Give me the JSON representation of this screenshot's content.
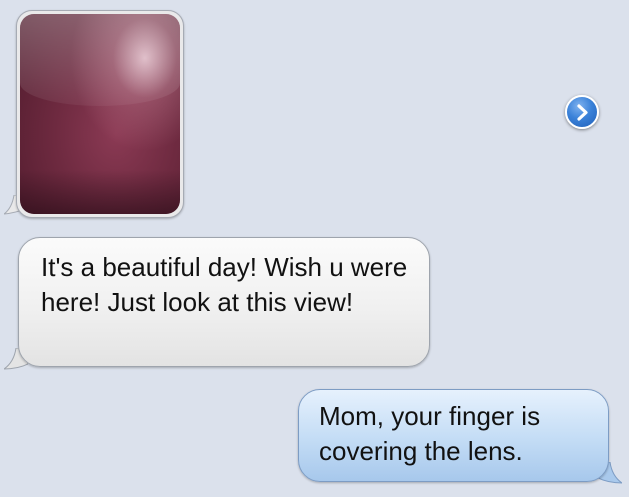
{
  "conversation": {
    "messages": [
      {
        "direction": "received",
        "type": "photo",
        "text": ""
      },
      {
        "direction": "received",
        "type": "text",
        "text": "It's a beautiful day! Wish u were here! Just look at this view!"
      },
      {
        "direction": "sent",
        "type": "text",
        "text": "Mom, your finger is covering the lens."
      }
    ]
  },
  "icons": {
    "disclosure": "chevron-right-circle-icon"
  },
  "colors": {
    "background": "#dbe1ec",
    "received_bubble": "#f0f0f0",
    "sent_bubble": "#c3dcf5",
    "disclosure_blue": "#3b82d9",
    "photo_tint": "#6e2a40"
  }
}
